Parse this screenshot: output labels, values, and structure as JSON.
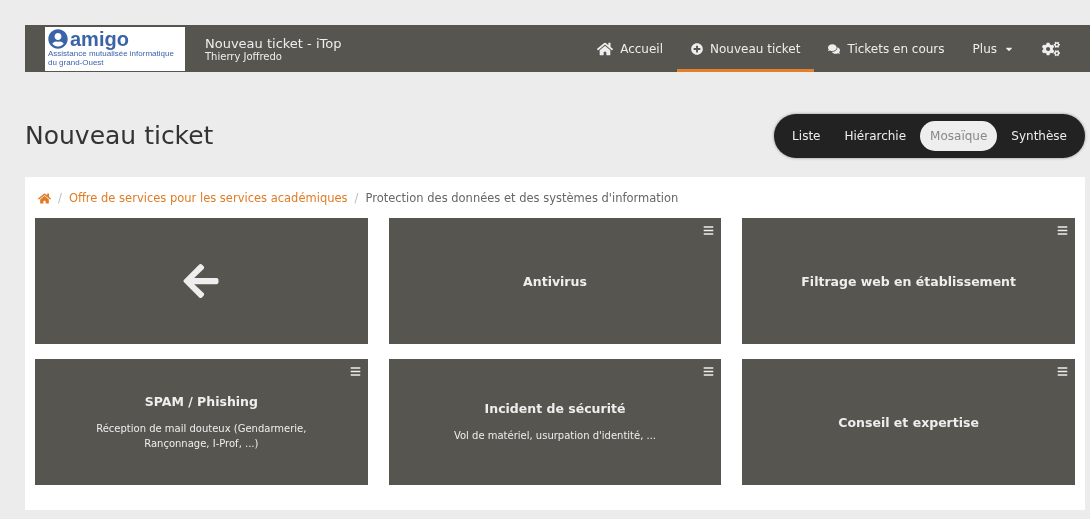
{
  "header": {
    "logo": {
      "name": "amigo",
      "tagline": "Assistance mutualisée informatique du grand-Ouest"
    },
    "title": "Nouveau ticket - iTop",
    "user": "Thierry Joffredo"
  },
  "nav": [
    {
      "kind": "home",
      "label": "Accueil",
      "selected": false
    },
    {
      "kind": "new",
      "label": "Nouveau ticket",
      "selected": true
    },
    {
      "kind": "chat",
      "label": "Tickets en cours",
      "selected": false
    },
    {
      "kind": "menu",
      "label": "Plus",
      "selected": false
    },
    {
      "kind": "settings",
      "selected": false
    }
  ],
  "page_title": "Nouveau ticket",
  "view_switch": [
    {
      "label": "Liste",
      "selected": false
    },
    {
      "label": "Hiérarchie",
      "selected": false
    },
    {
      "label": "Mosaïque",
      "selected": true
    },
    {
      "label": "Synthèse",
      "selected": false
    }
  ],
  "breadcrumb": [
    {
      "kind": "home"
    },
    {
      "kind": "link",
      "separator": "/",
      "label": "Offre de services pour les services académiques"
    },
    {
      "kind": "current",
      "separator": "/",
      "label": "Protection des données et des systèmes d'information"
    }
  ],
  "tiles": [
    {
      "kind": "back"
    },
    {
      "kind": "service",
      "title": "Antivirus"
    },
    {
      "kind": "service",
      "title": "Filtrage web en établissement"
    },
    {
      "kind": "service",
      "title": "SPAM / Phishing",
      "description": "Réception de mail douteux (Gendarmerie, Rançonnage, I-Prof, ...)"
    },
    {
      "kind": "service",
      "title": "Incident de sécurité",
      "description": "Vol de matériel, usurpation d'identité, ..."
    },
    {
      "kind": "service",
      "title": "Conseil et expertise"
    }
  ]
}
